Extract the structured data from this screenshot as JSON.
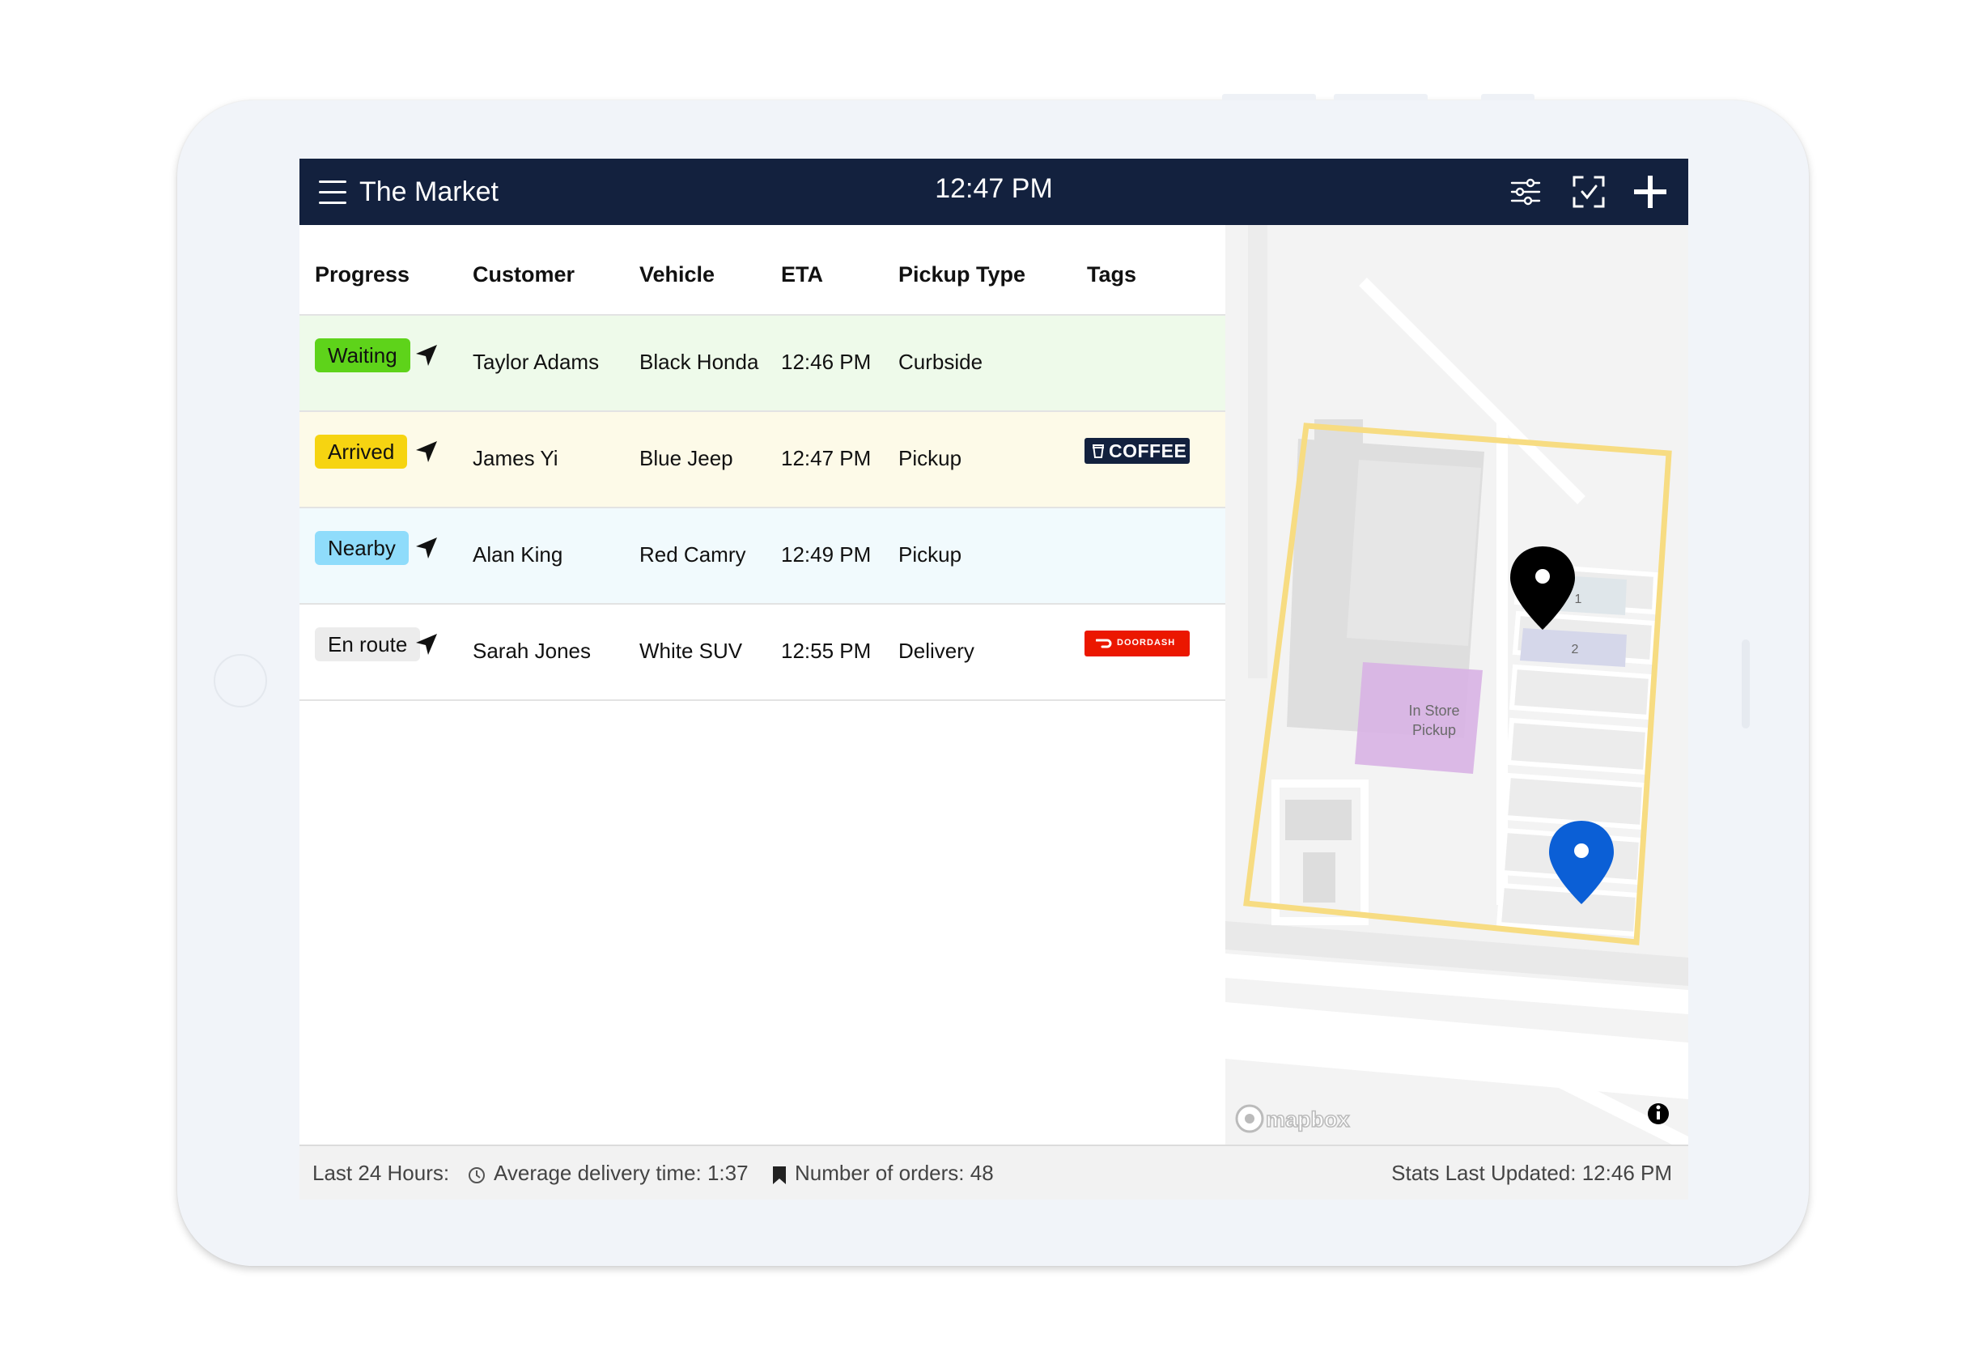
{
  "app": {
    "title": "The Market",
    "time": "12:47 PM"
  },
  "toolbar": {
    "icons": [
      "sliders-icon",
      "scan-check-icon",
      "plus-icon"
    ]
  },
  "table": {
    "headers": [
      "Progress",
      "Customer",
      "Vehicle",
      "ETA",
      "Pickup Type",
      "Tags"
    ],
    "rows": [
      {
        "status": "Waiting",
        "status_color": "#5ed31a",
        "row_color": "#eefaea",
        "customer": "Taylor Adams",
        "vehicle": "Black Honda",
        "eta": "12:46 PM",
        "pickup_type": "Curbside",
        "tag": ""
      },
      {
        "status": "Arrived",
        "status_color": "#f6d411",
        "row_color": "#fdfae8",
        "customer": "James Yi",
        "vehicle": "Blue Jeep",
        "eta": "12:47 PM",
        "pickup_type": "Pickup",
        "tag": "COFFEE"
      },
      {
        "status": "Nearby",
        "status_color": "#8fdcfb",
        "row_color": "#f1fafd",
        "customer": "Alan King",
        "vehicle": "Red Camry",
        "eta": "12:49 PM",
        "pickup_type": "Pickup",
        "tag": ""
      },
      {
        "status": "En route",
        "status_color": "#ececec",
        "row_color": "#ffffff",
        "customer": "Sarah Jones",
        "vehicle": "White SUV",
        "eta": "12:55 PM",
        "pickup_type": "Delivery",
        "tag": "DOORDASH"
      }
    ]
  },
  "map": {
    "zone_label_line1": "In Store",
    "zone_label_line2": "Pickup",
    "spot_1": "1",
    "spot_2": "2",
    "attribution": "mapbox",
    "geofence_color": "#f7dc82",
    "pin_colors": [
      "#000000",
      "#0b5fd6"
    ]
  },
  "footer": {
    "period": "Last 24 Hours:",
    "avg_delivery": "Average delivery time: 1:37",
    "order_count": "Number of orders: 48",
    "last_updated": "Stats Last Updated: 12:46 PM"
  }
}
